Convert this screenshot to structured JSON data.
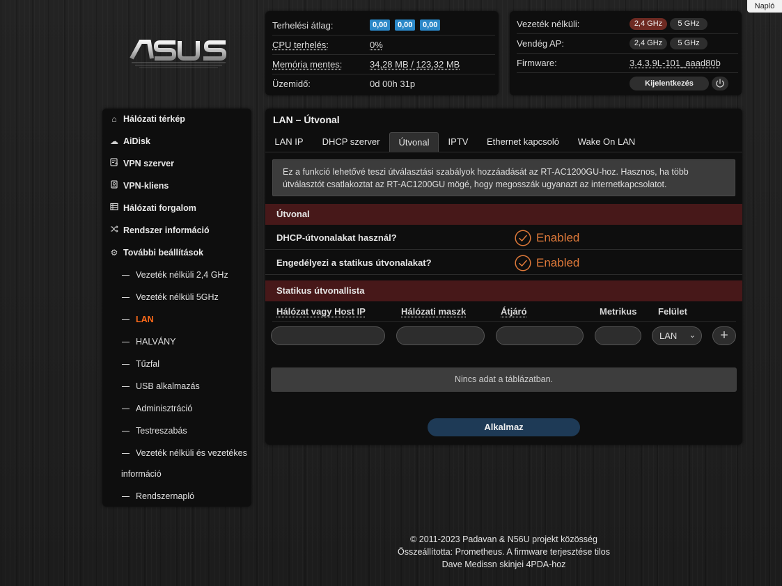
{
  "naplo_label": "Napló",
  "stats": {
    "load_label": "Terhelési átlag:",
    "load_values": [
      "0,00",
      "0,00",
      "0,00"
    ],
    "cpu_label": "CPU terhelés:",
    "cpu_value": "0%",
    "mem_label": "Memória mentes:",
    "mem_value": "34,28 MB / 123,32 MB",
    "uptime_label": "Üzemidő:",
    "uptime_value": "0d 00h 31p"
  },
  "wifi": {
    "wireless_label": "Vezeték nélküli:",
    "guest_label": "Vendég AP:",
    "firmware_label": "Firmware:",
    "band_24": "2,4 GHz",
    "band_5": "5 GHz",
    "firmware_value": "3.4.3.9L-101_aaad80b",
    "logout_label": "Kijelentkezés"
  },
  "sidebar": {
    "items": [
      {
        "label": "Hálózati térkép",
        "icon": "home-icon"
      },
      {
        "label": "AiDisk",
        "icon": "cloud-icon"
      },
      {
        "label": "VPN szerver",
        "icon": "vpn-server-icon"
      },
      {
        "label": "VPN-kliens",
        "icon": "vpn-client-icon"
      },
      {
        "label": "Hálózati forgalom",
        "icon": "traffic-icon"
      },
      {
        "label": "Rendszer információ",
        "icon": "shuffle-icon"
      },
      {
        "label": "További beállítások",
        "icon": "gear-icon"
      }
    ],
    "subitems": [
      "Vezeték nélküli 2,4 GHz",
      "Vezeték nélküli 5GHz",
      "LAN",
      "HALVÁNY",
      "Tűzfal",
      "USB alkalmazás",
      "Adminisztráció",
      "Testreszabás",
      "Vezeték nélküli és vezetékes",
      "információ",
      "Rendszernapló"
    ]
  },
  "main": {
    "title": "LAN – Útvonal",
    "tabs": [
      "LAN IP",
      "DHCP szerver",
      "Útvonal",
      "IPTV",
      "Ethernet kapcsoló",
      "Wake On LAN"
    ],
    "info_text": "Ez a funkció lehetővé teszi útválasztási szabályok hozzáadását az RT-AC1200GU-hoz. Hasznos, ha több útválasztót csatlakoztat az RT-AC1200GU mögé, hogy megosszák ugyanazt az internetkapcsolatot.",
    "section1": "Útvonal",
    "dhcp_routes_label": "DHCP-útvonalakat használ?",
    "static_routes_label": "Engedélyezi a statikus útvonalakat?",
    "enabled_text": "Enabled",
    "section2": "Statikus útvonallista",
    "columns": [
      "Hálózat vagy Host IP",
      "Hálózati maszk",
      "Átjáró",
      "Metrikus",
      "Felület"
    ],
    "iface_value": "LAN",
    "add_symbol": "+",
    "no_data": "Nincs adat a táblázatban.",
    "apply_label": "Alkalmaz"
  },
  "footer": {
    "line1": "© 2011-2023 Padavan & N56U projekt közösség",
    "line2": "Összeállította: Prometheus. A firmware terjesztése tilos",
    "line3": "Dave Medissn skinjei 4PDA-hoz"
  },
  "colors": {
    "accent_orange": "#ff6a1a",
    "section_red": "#471819",
    "badge_blue": "#2b88c8",
    "apply_blue": "#1e3a56"
  }
}
